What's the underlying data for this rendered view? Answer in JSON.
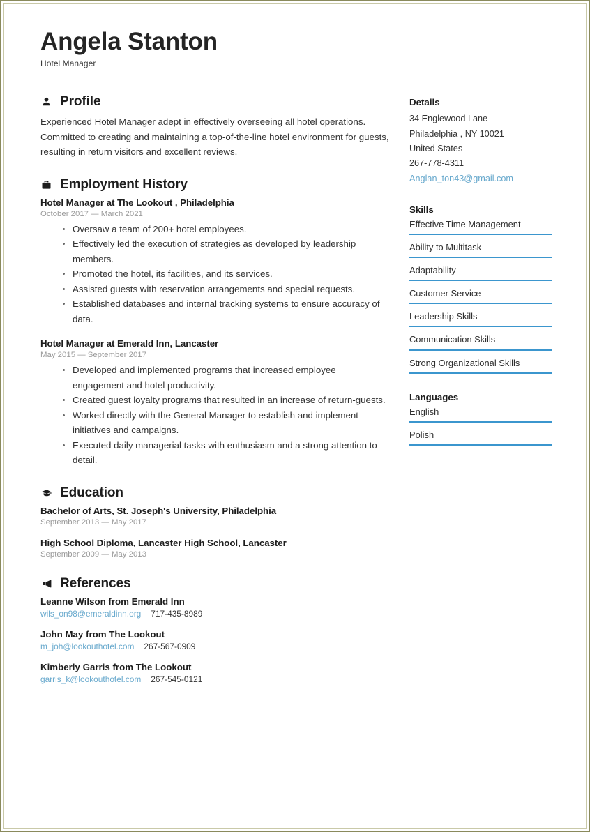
{
  "header": {
    "name": "Angela Stanton",
    "job_title": "Hotel Manager"
  },
  "sections": {
    "profile": {
      "title": "Profile",
      "icon": "person-icon",
      "text": "Experienced Hotel Manager adept in effectively overseeing all hotel operations. Committed to creating and maintaining a top-of-the-line hotel environment for guests, resulting in return visitors and excellent reviews."
    },
    "employment": {
      "title": "Employment History",
      "icon": "briefcase-icon",
      "entries": [
        {
          "title": "Hotel Manager at The Lookout , Philadelphia",
          "date": "October 2017 — March 2021",
          "bullets": [
            "Oversaw a team of 200+ hotel employees.",
            "Effectively led the execution of strategies as developed by leadership members.",
            "Promoted the hotel, its facilities, and its services.",
            "Assisted guests with reservation arrangements and special requests.",
            "Established databases and internal tracking systems to ensure accuracy of data."
          ]
        },
        {
          "title": "Hotel Manager at Emerald Inn, Lancaster",
          "date": "May 2015 — September 2017",
          "bullets": [
            "Developed and implemented programs that increased employee engagement and hotel productivity.",
            "Created guest loyalty programs that resulted in an increase of return-guests.",
            "Worked directly with the General Manager to establish and implement initiatives and campaigns.",
            "Executed daily managerial tasks with enthusiasm and a strong attention to detail."
          ]
        }
      ]
    },
    "education": {
      "title": "Education",
      "icon": "graduation-cap-icon",
      "entries": [
        {
          "title": "Bachelor of Arts, St. Joseph's University, Philadelphia",
          "date": "September 2013 — May 2017"
        },
        {
          "title": "High School Diploma, Lancaster High School, Lancaster",
          "date": "September 2009 — May 2013"
        }
      ]
    },
    "references": {
      "title": "References",
      "icon": "megaphone-icon",
      "entries": [
        {
          "name": "Leanne Wilson from Emerald Inn",
          "email": "wils_on98@emeraldinn.org",
          "phone": "717-435-8989"
        },
        {
          "name": "John May from The Lookout",
          "email": "m_joh@lookouthotel.com",
          "phone": "267-567-0909"
        },
        {
          "name": "Kimberly Garris from The Lookout",
          "email": "garris_k@lookouthotel.com",
          "phone": "267-545-0121"
        }
      ]
    }
  },
  "sidebar": {
    "details": {
      "title": "Details",
      "address_line1": "34 Englewood Lane",
      "address_line2": "Philadelphia , NY 10021",
      "country": "United States",
      "phone": "267-778-4311",
      "email": "Anglan_ton43@gmail.com"
    },
    "skills": {
      "title": "Skills",
      "items": [
        "Effective Time Management",
        "Ability to Multitask",
        "Adaptability",
        "Customer Service",
        "Leadership Skills",
        "Communication Skills",
        "Strong Organizational Skills"
      ]
    },
    "languages": {
      "title": "Languages",
      "items": [
        "English",
        "Polish"
      ]
    }
  },
  "colors": {
    "accent_bar": "#3b96ce",
    "link": "#68a9cd",
    "heading": "#1d1d1d",
    "muted": "#9b9b9b",
    "page_border": "#8a8a5c"
  }
}
